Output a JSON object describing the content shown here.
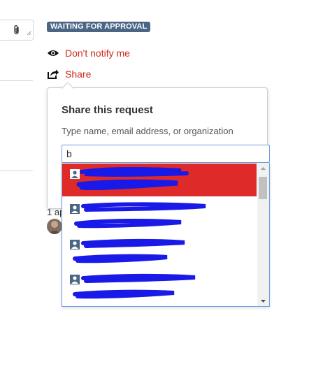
{
  "status": {
    "label": "WAITING FOR APPROVAL",
    "color": "#4b6584"
  },
  "actions": {
    "notify": {
      "label": "Don't notify me",
      "icon": "eye-icon"
    },
    "share": {
      "label": "Share",
      "icon": "share-icon"
    }
  },
  "accent": "#d0271d",
  "share_popover": {
    "title": "Share this request",
    "hint": "Type name, email address, or organization",
    "search": {
      "value": "b"
    },
    "results": [
      {
        "icon": "user-icon",
        "selected": true
      },
      {
        "icon": "user-icon",
        "selected": false
      },
      {
        "icon": "user-icon",
        "selected": false
      },
      {
        "icon": "user-icon",
        "selected": false
      }
    ]
  },
  "comment": {
    "meta": "1 ap"
  }
}
